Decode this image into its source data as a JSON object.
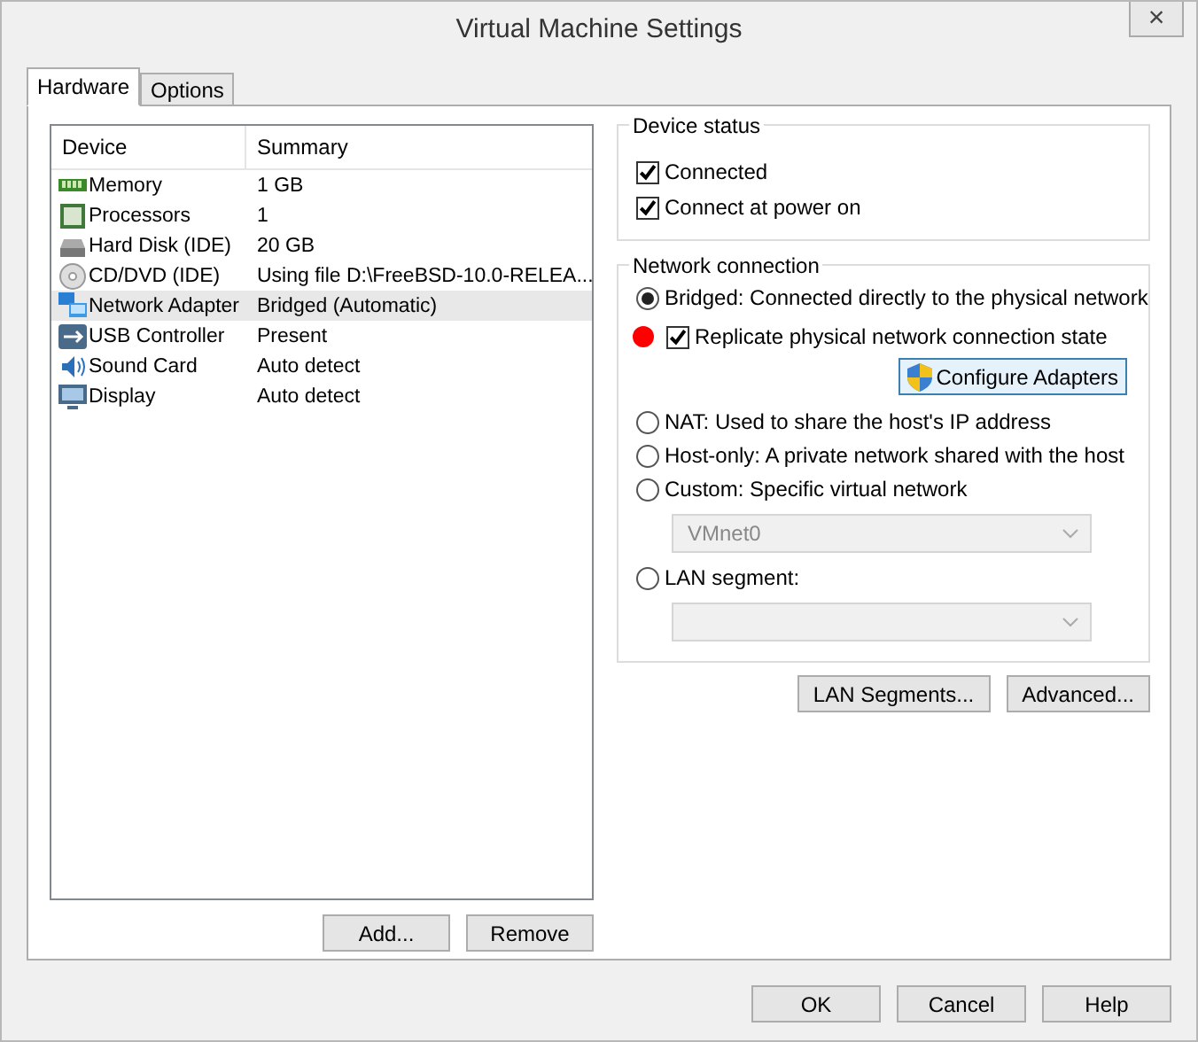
{
  "window": {
    "title": "Virtual Machine Settings",
    "close": "×"
  },
  "tabs": [
    {
      "label": "Hardware",
      "selected": true
    },
    {
      "label": "Options",
      "selected": false
    }
  ],
  "device_table": {
    "columns": [
      "Device",
      "Summary"
    ],
    "rows": [
      {
        "device": "Memory",
        "summary": "1 GB",
        "selected": false
      },
      {
        "device": "Processors",
        "summary": "1",
        "selected": false
      },
      {
        "device": "Hard Disk (IDE)",
        "summary": "20 GB",
        "selected": false
      },
      {
        "device": "CD/DVD (IDE)",
        "summary": "Using file D:\\FreeBSD-10.0-RELEA...",
        "selected": false
      },
      {
        "device": "Network Adapter",
        "summary": "Bridged (Automatic)",
        "selected": true
      },
      {
        "device": "USB Controller",
        "summary": "Present",
        "selected": false
      },
      {
        "device": "Sound Card",
        "summary": "Auto detect",
        "selected": false
      },
      {
        "device": "Display",
        "summary": "Auto detect",
        "selected": false
      }
    ]
  },
  "table_buttons": [
    "Add...",
    "Remove"
  ],
  "device_status": {
    "title": "Device status",
    "options": [
      {
        "label": "Connected",
        "checked": true
      },
      {
        "label": "Connect at power on",
        "checked": true
      }
    ]
  },
  "network_connection": {
    "title": "Network connection",
    "bridged": {
      "label": "Bridged: Connected directly to the physical network",
      "selected": true
    },
    "replicate": {
      "label": "Replicate physical network connection state",
      "checked": true,
      "marker": true
    },
    "configure_button": "Configure Adapters",
    "nat": {
      "label": "NAT: Used to share the host's IP address",
      "selected": false
    },
    "host_only": {
      "label": "Host-only: A private network shared with the host",
      "selected": false
    },
    "custom": {
      "label": "Custom: Specific virtual network",
      "selected": false
    },
    "custom_select": {
      "value": "VMnet0",
      "disabled": true
    },
    "lan_segment": {
      "label": "LAN segment:",
      "selected": false
    },
    "lan_select": {
      "disabled": true
    }
  },
  "network_buttons": [
    "LAN Segments...",
    "Advanced..."
  ],
  "dialog_buttons": [
    "OK",
    "Cancel",
    "Help"
  ]
}
